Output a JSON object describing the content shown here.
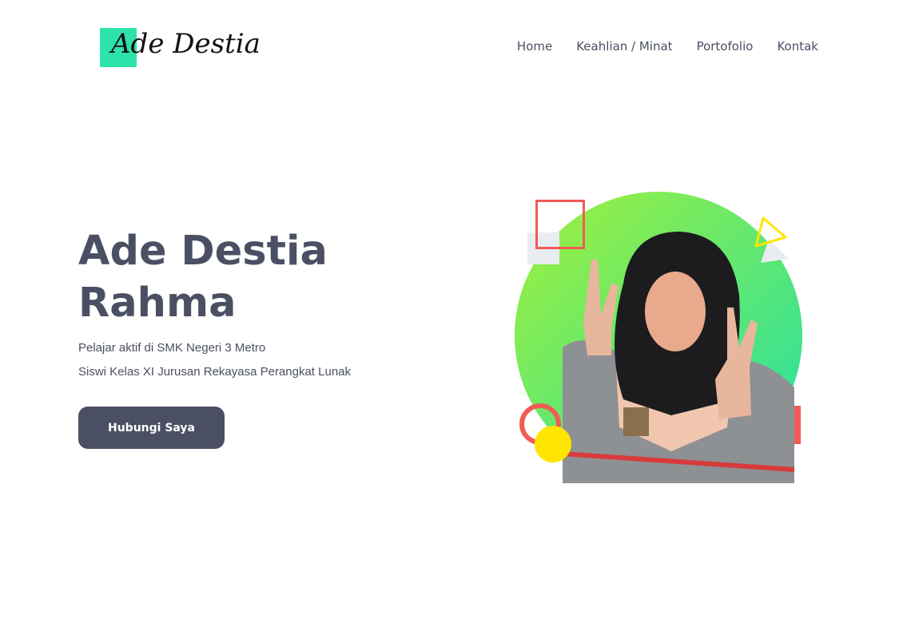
{
  "header": {
    "logo_text": "Ade Destia",
    "nav": [
      {
        "label": "Home"
      },
      {
        "label": "Keahlian / Minat"
      },
      {
        "label": "Portofolio"
      },
      {
        "label": "Kontak"
      }
    ]
  },
  "hero": {
    "title": "Ade Destia Rahma",
    "line1": "Pelajar aktif di SMK Negeri 3 Metro",
    "line2": "Siswi Kelas XI Jurusan Rekayasa Perangkat Lunak",
    "cta_label": "Hubungi Saya"
  },
  "colors": {
    "text_dark": "#4a4f63",
    "logo_accent": "#2ee2ab",
    "gradient_start": "#a3f03a",
    "gradient_end": "#22dfa6",
    "shape_red": "#f25c54",
    "shape_yellow": "#ffe500"
  },
  "illustration": {
    "subject": "portrait-photo",
    "icons": [
      "square-outline-icon",
      "triangle-outline-icon",
      "ring-icon",
      "circle-icon"
    ]
  }
}
